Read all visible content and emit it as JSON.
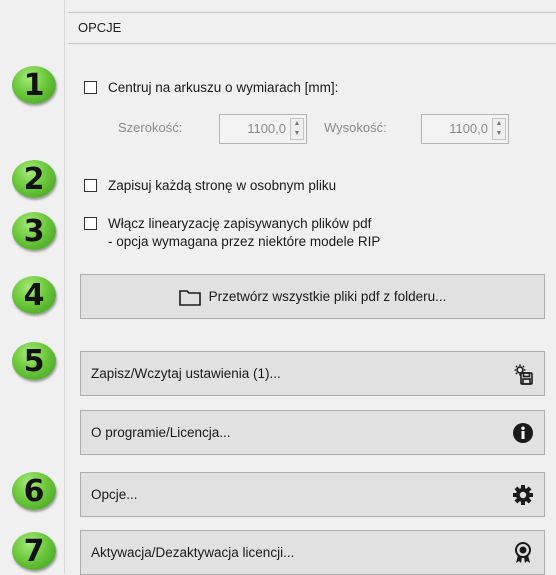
{
  "header": {
    "title": "OPCJE"
  },
  "steps": [
    "1",
    "2",
    "3",
    "4",
    "5",
    "6",
    "7"
  ],
  "center": {
    "checkbox_label": "Centruj na arkuszu o wymiarach [mm]:",
    "width_label": "Szerokość:",
    "width_value": "1100,0",
    "height_label": "Wysokość:",
    "height_value": "1100,0"
  },
  "options": {
    "separate_files_label": "Zapisuj każdą stronę w osobnym pliku",
    "linearize_line1": "Włącz linearyzację zapisywanych plików pdf",
    "linearize_line2": "- opcja wymagana przez niektóre modele RIP"
  },
  "buttons": {
    "process_folder": "Przetwórz wszystkie pliki pdf z folderu...",
    "save_load": "Zapisz/Wczytaj ustawienia (1)...",
    "about": "O programie/Licencja...",
    "options": "Opcje...",
    "activation": "Aktywacja/Dezaktywacja licencji..."
  },
  "icons": {
    "process_folder": "folder-icon",
    "save_load": "settings-save-icon",
    "about": "info-icon",
    "options": "gear-icon",
    "activation": "license-badge-icon"
  },
  "colors": {
    "badge_green": "#6cc83c",
    "button_bg": "#e1e1e1",
    "panel_bg": "#f0f0f0"
  }
}
